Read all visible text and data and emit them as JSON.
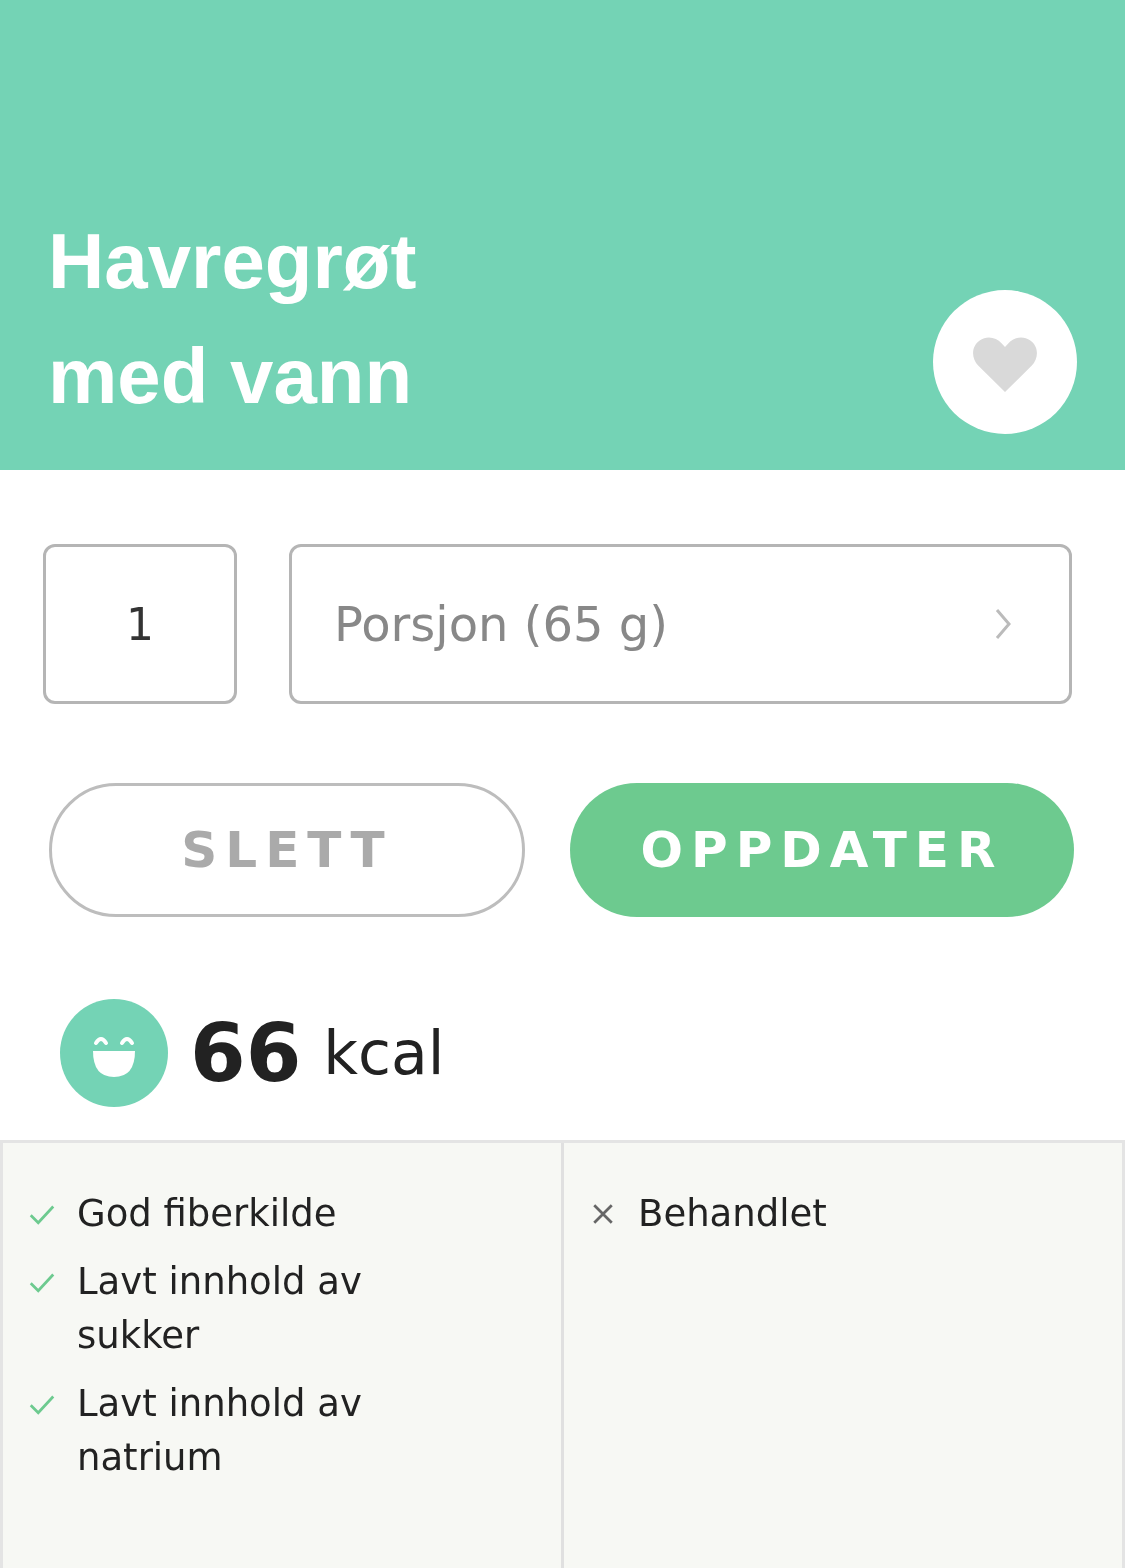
{
  "header": {
    "title": "Havregrøt med vann",
    "favorite": false
  },
  "quantity": {
    "value": "1"
  },
  "unit": {
    "value": "Porsjon (65 g)"
  },
  "buttons": [
    {
      "label": "SLETT",
      "kind": "secondary"
    },
    {
      "label": "OPPDATER",
      "kind": "primary"
    }
  ],
  "energy": {
    "value": "66",
    "unit": "kcal"
  },
  "positives": [
    "God fiberkilde",
    "Lavt innhold av sukker",
    "Lavt innhold av natrium"
  ],
  "negatives": [
    "Behandlet"
  ]
}
